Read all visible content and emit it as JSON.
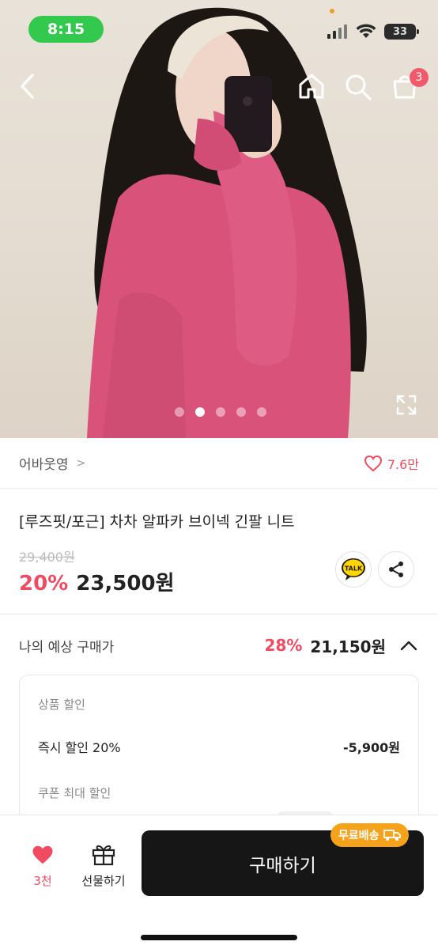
{
  "status": {
    "time": "8:15",
    "battery": "33"
  },
  "header": {
    "cart_count": "3"
  },
  "carousel": {
    "slide_count": 5,
    "active_index": 1
  },
  "store": {
    "name": "어바웃영",
    "like_count": "7.6만"
  },
  "product": {
    "title": "[루즈핏/포근] 차차 알파카 브이넥 긴팔 니트",
    "original_price": "29,400원",
    "discount_rate": "20%",
    "price": "23,500원",
    "talk_label": "TALK"
  },
  "expected": {
    "label": "나의 예상 구매가",
    "discount_rate": "28%",
    "price": "21,150원"
  },
  "details": {
    "product_discount_label": "상품 할인",
    "instant_discount_label": "즉시 할인 20%",
    "instant_discount_amount": "-5,900원",
    "coupon_label": "쿠폰 최대 할인"
  },
  "bottom": {
    "wish_count": "3천",
    "gift_label": "선물하기",
    "buy_label": "구매하기",
    "free_shipping_label": "무료배송"
  },
  "colors": {
    "accent": "#f04b61",
    "status_pill": "#33c94e",
    "buy_button": "#161616",
    "free_ship_badge": "#f7a21b"
  }
}
